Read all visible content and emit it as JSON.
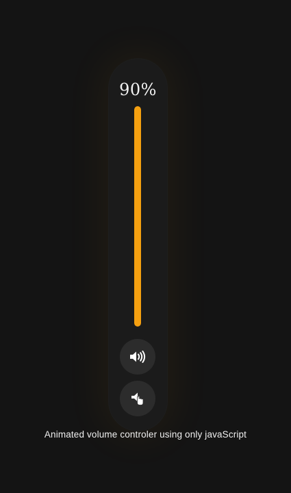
{
  "volume": {
    "percent_label": "90%",
    "level_fraction": 1.0
  },
  "buttons": {
    "volume_icon": "speaker-wave-icon",
    "mute_icon": "speaker-mute-icon"
  },
  "caption": "Animated volume controler using only javaScript",
  "colors": {
    "background": "#141414",
    "panel": "#1b1b1b",
    "accent": "#f5a010",
    "button_bg": "#2c2c2c",
    "text": "#f2f2f2"
  }
}
